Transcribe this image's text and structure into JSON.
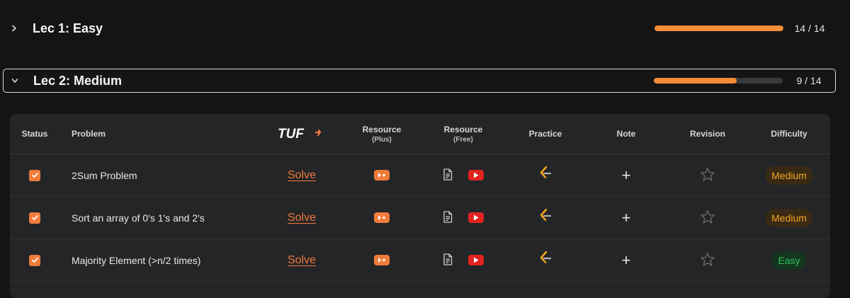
{
  "sections": [
    {
      "title": "Lec 1: Easy",
      "progress_text": "14 / 14",
      "progress": 1.0,
      "expanded": false
    },
    {
      "title": "Lec 2: Medium",
      "progress_text": "9 / 14",
      "progress": 0.643,
      "expanded": true
    }
  ],
  "table": {
    "headers": {
      "status": "Status",
      "problem": "Problem",
      "tuf_logo": "TUF",
      "resource_plus": "Resource",
      "resource_plus_sub": "(Plus)",
      "resource_free": "Resource",
      "resource_free_sub": "(Free)",
      "practice": "Practice",
      "note": "Note",
      "revision": "Revision",
      "difficulty": "Difficulty"
    },
    "rows": [
      {
        "checked": true,
        "problem": "2Sum Problem",
        "solve": "Solve",
        "difficulty": "Medium"
      },
      {
        "checked": true,
        "problem": "Sort an array of 0's 1's and 2's",
        "solve": "Solve",
        "difficulty": "Medium"
      },
      {
        "checked": true,
        "problem": "Majority Element (>n/2 times)",
        "solve": "Solve",
        "difficulty": "Easy"
      }
    ]
  },
  "colors": {
    "accent": "#f07c3b",
    "progress": "#f28c36",
    "youtube": "#e1231f",
    "medium": "#f5a623",
    "easy": "#30c45a"
  },
  "icons": {
    "collapsed": "chevron-right-icon",
    "expanded": "chevron-down-icon",
    "article": "document-icon",
    "video": "youtube-icon",
    "practice": "leetcode-icon",
    "note": "plus-icon",
    "revision": "star-icon"
  }
}
